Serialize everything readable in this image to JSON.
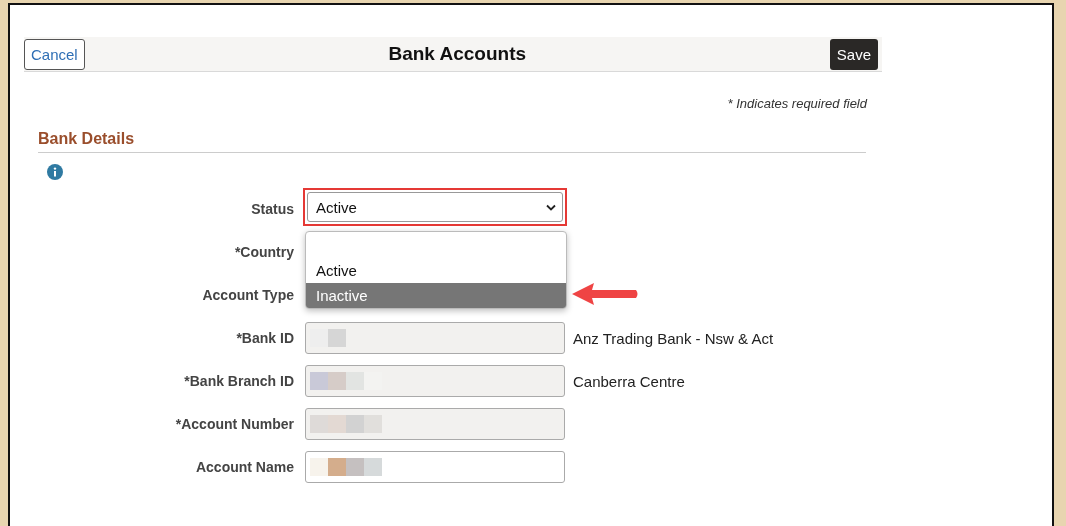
{
  "header": {
    "cancel": "Cancel",
    "title": "Bank Accounts",
    "save": "Save"
  },
  "required_note": "* Indicates required field",
  "section": {
    "title": "Bank Details"
  },
  "fields": [
    {
      "label": "Status",
      "kind": "select",
      "value": "Active",
      "highlighted": true
    },
    {
      "label": "*Country",
      "kind": "covered"
    },
    {
      "label": "Account Type",
      "kind": "covered"
    },
    {
      "label": "*Bank ID",
      "kind": "readonly",
      "redacted": true,
      "description": "Anz Trading Bank - Nsw & Act"
    },
    {
      "label": "*Bank Branch ID",
      "kind": "readonly",
      "redacted": true,
      "description": "Canberra Centre"
    },
    {
      "label": "*Account Number",
      "kind": "readonly",
      "redacted": true
    },
    {
      "label": "Account Name",
      "kind": "text",
      "redacted": true
    }
  ],
  "dropdown": {
    "options": [
      {
        "label": "Active",
        "selected": false
      },
      {
        "label": "Inactive",
        "selected": true
      }
    ],
    "arrow": true
  }
}
